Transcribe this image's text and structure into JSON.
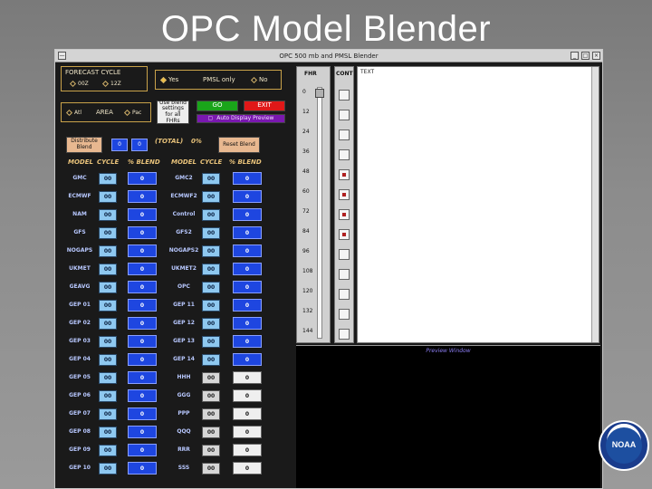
{
  "slide": {
    "title": "OPC Model Blender"
  },
  "window": {
    "title": "OPC 500 mb and PMSL Blender"
  },
  "forecast_cycle": {
    "label": "FORECAST CYCLE",
    "options": [
      "00Z",
      "12Z"
    ]
  },
  "pmsl_only": {
    "label": "PMSL only",
    "yes": "Yes",
    "no": "No"
  },
  "area": {
    "label": "AREA",
    "options": [
      "Atl",
      "Pac"
    ]
  },
  "use_blend": {
    "label": "Use blend settings for all FHRs"
  },
  "go_button": "GO",
  "exit_button": "EXIT",
  "auto_display": "Auto Display Preview",
  "distribute": {
    "label": "Distribute Blend",
    "value1": "0",
    "value2": "0"
  },
  "total": {
    "label": "(TOTAL)",
    "value": "0%"
  },
  "reset_blend": "Reset Blend",
  "headers": {
    "model": "MODEL",
    "cycle": "CYCLE",
    "blend": "% BLEND"
  },
  "left_models": [
    {
      "name": "GMC",
      "cycle": "00",
      "pct": "0"
    },
    {
      "name": "ECMWF",
      "cycle": "00",
      "pct": "0"
    },
    {
      "name": "NAM",
      "cycle": "00",
      "pct": "0"
    },
    {
      "name": "GFS",
      "cycle": "00",
      "pct": "0"
    },
    {
      "name": "NOGAPS",
      "cycle": "00",
      "pct": "0"
    },
    {
      "name": "UKMET",
      "cycle": "00",
      "pct": "0"
    },
    {
      "name": "GEAVG",
      "cycle": "00",
      "pct": "0"
    },
    {
      "name": "GEP 01",
      "cycle": "00",
      "pct": "0"
    },
    {
      "name": "GEP 02",
      "cycle": "00",
      "pct": "0"
    },
    {
      "name": "GEP 03",
      "cycle": "00",
      "pct": "0"
    },
    {
      "name": "GEP 04",
      "cycle": "00",
      "pct": "0"
    },
    {
      "name": "GEP 05",
      "cycle": "00",
      "pct": "0"
    },
    {
      "name": "GEP 06",
      "cycle": "00",
      "pct": "0"
    },
    {
      "name": "GEP 07",
      "cycle": "00",
      "pct": "0"
    },
    {
      "name": "GEP 08",
      "cycle": "00",
      "pct": "0"
    },
    {
      "name": "GEP 09",
      "cycle": "00",
      "pct": "0"
    },
    {
      "name": "GEP 10",
      "cycle": "00",
      "pct": "0"
    }
  ],
  "right_models": [
    {
      "name": "GMC2",
      "cycle": "00",
      "pct": "0"
    },
    {
      "name": "ECMWF2",
      "cycle": "00",
      "pct": "0"
    },
    {
      "name": "Control",
      "cycle": "00",
      "pct": "0"
    },
    {
      "name": "GFS2",
      "cycle": "00",
      "pct": "0"
    },
    {
      "name": "NOGAPS2",
      "cycle": "00",
      "pct": "0"
    },
    {
      "name": "UKMET2",
      "cycle": "00",
      "pct": "0"
    },
    {
      "name": "OPC",
      "cycle": "00",
      "pct": "0"
    },
    {
      "name": "GEP 11",
      "cycle": "00",
      "pct": "0"
    },
    {
      "name": "GEP 12",
      "cycle": "00",
      "pct": "0"
    },
    {
      "name": "GEP 13",
      "cycle": "00",
      "pct": "0"
    },
    {
      "name": "GEP 14",
      "cycle": "00",
      "pct": "0"
    },
    {
      "name": "HHH",
      "cycle": "00",
      "pct": "0"
    },
    {
      "name": "GGG",
      "cycle": "00",
      "pct": "0"
    },
    {
      "name": "PPP",
      "cycle": "00",
      "pct": "0"
    },
    {
      "name": "QQQ",
      "cycle": "00",
      "pct": "0"
    },
    {
      "name": "RRR",
      "cycle": "00",
      "pct": "0"
    },
    {
      "name": "SSS",
      "cycle": "00",
      "pct": "0"
    }
  ],
  "fhr": {
    "label": "FHR",
    "hours": [
      "0",
      "12",
      "24",
      "36",
      "48",
      "60",
      "72",
      "84",
      "96",
      "108",
      "120",
      "132",
      "144"
    ]
  },
  "cont": {
    "label": "CONT",
    "checked": [
      false,
      false,
      false,
      false,
      true,
      true,
      true,
      true,
      false,
      false,
      false,
      false,
      false
    ]
  },
  "text_panel": {
    "label": "TEXT"
  },
  "preview_window": {
    "label": "Preview Window"
  },
  "logo": {
    "text": "NOAA"
  },
  "colors": {
    "title_color": "#ffffff",
    "window_bg": "#1a1a1a",
    "cycle_blue": "#8ec8f0",
    "pct_blue": "#1e46e0",
    "go_green": "#1aa51a",
    "exit_red": "#e01818",
    "auto_purple": "#7a18b0",
    "distribute_tan": "#e8b890"
  }
}
